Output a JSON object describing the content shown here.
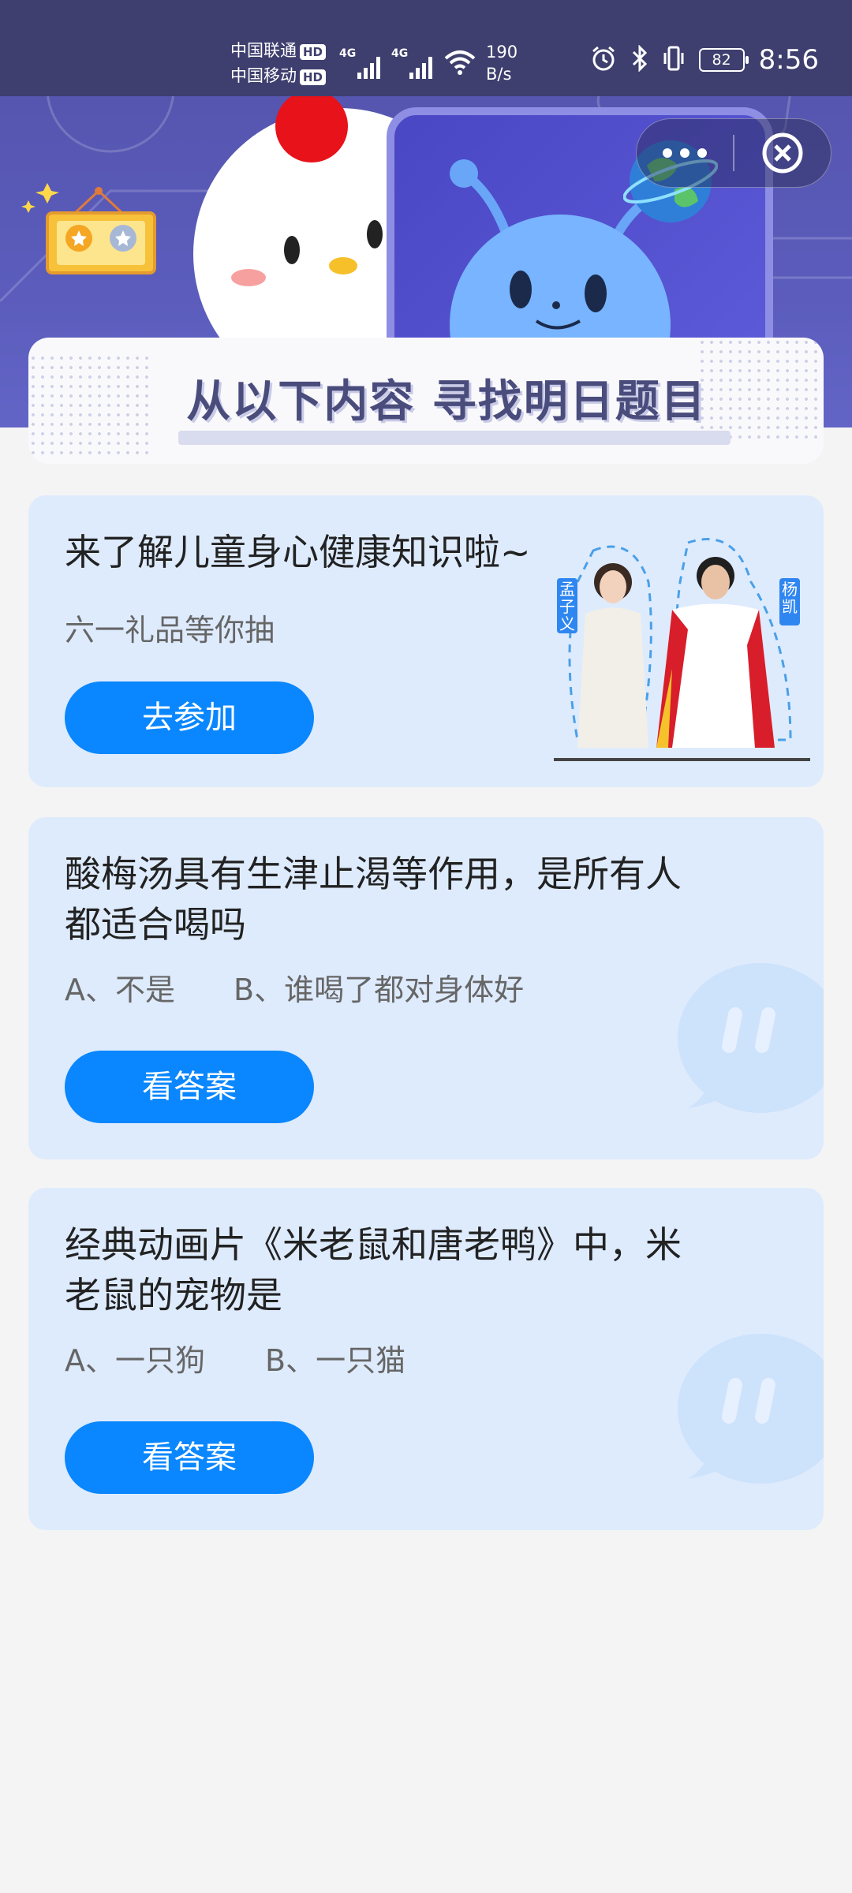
{
  "status_bar": {
    "carrier1": "中国联通",
    "carrier2": "中国移动",
    "hd": "HD",
    "net1": "4G",
    "net2": "4G",
    "speed_value": "190",
    "speed_unit": "B/s",
    "battery": "82",
    "time": "8:56"
  },
  "banner": {
    "title": "从以下内容  寻找明日题目"
  },
  "cards": [
    {
      "title": "来了解儿童身心健康知识啦~",
      "subtitle": "六一礼品等你抽",
      "button": "去参加",
      "person1": "孟子义",
      "person2": "杨凯"
    },
    {
      "title_line1": "酸梅汤具有生津止渴等作用，是所有人",
      "title_line2": "都适合喝吗",
      "option_a": "A、不是",
      "option_b": "B、谁喝了都对身体好",
      "button": "看答案"
    },
    {
      "title_line1": "经典动画片《米老鼠和唐老鸭》中，米",
      "title_line2": "老鼠的宠物是",
      "option_a": "A、一只狗",
      "option_b": "B、一只猫",
      "button": "看答案"
    }
  ],
  "colors": {
    "status_bg": "#3e3f6e",
    "banner_bg": "#5b5cbc",
    "card_bg": "#deebfd",
    "button_bg": "#0a87fe",
    "page_bg": "#f4f4f4"
  }
}
